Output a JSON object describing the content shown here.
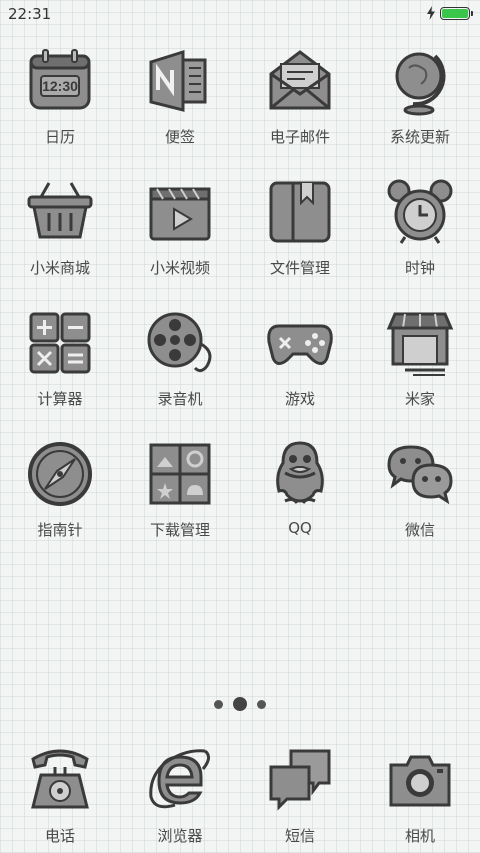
{
  "status_bar": {
    "time": "22:31",
    "battery_level": 1.0,
    "charging": true,
    "battery_color": "#3ac64a"
  },
  "apps": [
    [
      {
        "label": "日历",
        "icon": "calendar-icon"
      },
      {
        "label": "便签",
        "icon": "notes-icon"
      },
      {
        "label": "电子邮件",
        "icon": "email-icon"
      },
      {
        "label": "系统更新",
        "icon": "globe-icon"
      }
    ],
    [
      {
        "label": "小米商城",
        "icon": "basket-icon"
      },
      {
        "label": "小米视频",
        "icon": "video-icon"
      },
      {
        "label": "文件管理",
        "icon": "file-manager-icon"
      },
      {
        "label": "时钟",
        "icon": "alarm-clock-icon"
      }
    ],
    [
      {
        "label": "计算器",
        "icon": "calculator-icon"
      },
      {
        "label": "录音机",
        "icon": "recorder-icon"
      },
      {
        "label": "游戏",
        "icon": "gamepad-icon"
      },
      {
        "label": "米家",
        "icon": "store-icon"
      }
    ],
    [
      {
        "label": "指南针",
        "icon": "compass-icon"
      },
      {
        "label": "下载管理",
        "icon": "download-manager-icon"
      },
      {
        "label": "QQ",
        "icon": "qq-penguin-icon"
      },
      {
        "label": "微信",
        "icon": "wechat-icon"
      }
    ]
  ],
  "page_indicator": {
    "count": 3,
    "active": 1
  },
  "dock": [
    {
      "label": "电话",
      "icon": "telephone-icon"
    },
    {
      "label": "浏览器",
      "icon": "browser-icon"
    },
    {
      "label": "短信",
      "icon": "messages-icon"
    },
    {
      "label": "相机",
      "icon": "camera-icon"
    }
  ],
  "icon_fill": "#8e8e8e",
  "icon_stroke": "#3a3a3a"
}
